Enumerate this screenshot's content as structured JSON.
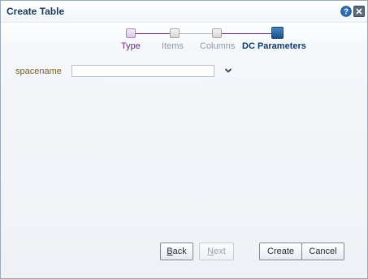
{
  "dialog": {
    "title": "Create Table"
  },
  "train": {
    "stops": [
      {
        "label": "Type",
        "state": "visited"
      },
      {
        "label": "Items",
        "state": "unvisited"
      },
      {
        "label": "Columns",
        "state": "unvisited"
      },
      {
        "label": "DC Parameters",
        "state": "current"
      }
    ]
  },
  "form": {
    "spacename_label": "spacename",
    "spacename_value": ""
  },
  "buttons": {
    "back_mnemonic": "B",
    "back_rest": "ack",
    "next_mnemonic": "N",
    "next_rest": "ext",
    "create": "Create",
    "cancel": "Cancel"
  },
  "icons": {
    "help": "help-icon",
    "close": "close-icon",
    "dropdown": "chevron-down-icon"
  },
  "colors": {
    "title": "#1a3a5a",
    "visited": "#6c2a7e",
    "current": "#0e3c68",
    "label": "#7a5c14"
  }
}
